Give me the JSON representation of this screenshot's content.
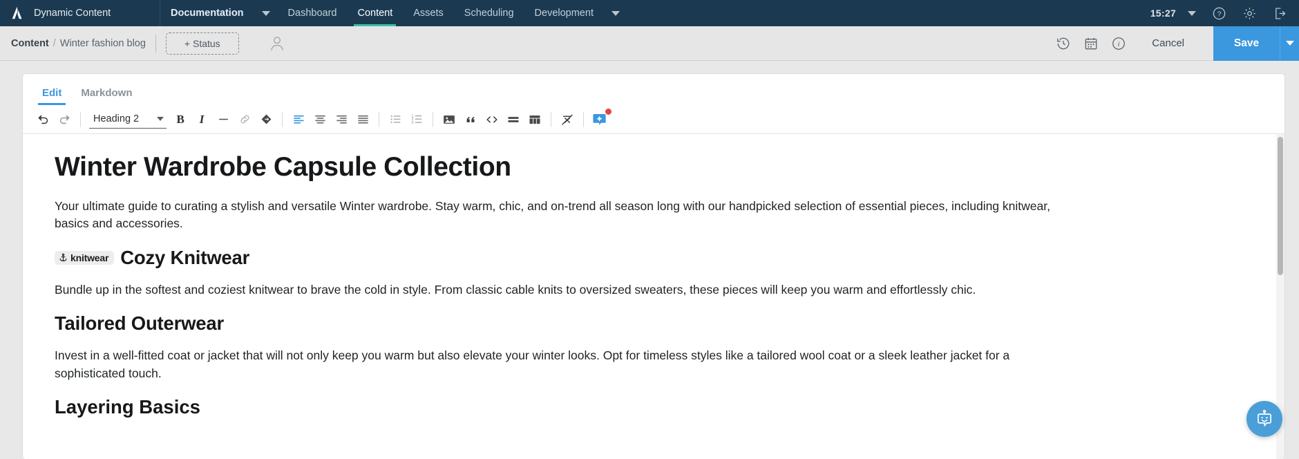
{
  "topnav": {
    "logo_icon": "amplience-logo-icon",
    "brand": "Dynamic Content",
    "items": [
      {
        "label": "Documentation",
        "icon": "",
        "active": false,
        "strong": true
      },
      {
        "label": "Dashboard",
        "active": false
      },
      {
        "label": "Content",
        "active": true
      },
      {
        "label": "Assets",
        "active": false
      },
      {
        "label": "Scheduling",
        "active": false
      },
      {
        "label": "Development",
        "active": false
      }
    ],
    "caret_icon": "chevron-down-icon",
    "clock": "15:27",
    "user_caret_icon": "chevron-down-icon",
    "help_icon": "help-circle-icon",
    "settings_icon": "gear-icon",
    "signout_icon": "sign-out-icon",
    "bg_color": "#1b3a52",
    "active_underline_color": "#39c0a5"
  },
  "subbar": {
    "crumb_root": "Content",
    "crumb_sep": "/",
    "crumb_current": "Winter fashion blog",
    "status_button": "+ Status",
    "avatar_icon": "user-avatar-icon",
    "history_icon": "history-clock-icon",
    "schedule_icon": "calendar-icon",
    "info_icon": "info-circle-icon",
    "cancel_label": "Cancel",
    "save_label": "Save",
    "save_caret_icon": "chevron-down-icon",
    "save_color": "#3b97de"
  },
  "editor": {
    "tabs": [
      {
        "label": "Edit",
        "active": true
      },
      {
        "label": "Markdown",
        "active": false
      }
    ],
    "toolbar": {
      "undo_icon": "undo-arrow-icon",
      "redo_icon": "redo-arrow-icon",
      "block_style": "Heading 2",
      "block_style_caret": "chevron-down-icon",
      "bold_label": "B",
      "italic_label": "I",
      "horizontal_rule_icon": "horizontal-rule-icon",
      "link_icon": "link-chain-icon",
      "anchor_icon": "anchor-tag-icon",
      "align_left_icon": "align-left-icon",
      "align_center_icon": "align-center-icon",
      "align_right_icon": "align-right-icon",
      "align_justify_icon": "align-justify-icon",
      "bullet_list_icon": "bulleted-list-icon",
      "numbered_list_icon": "numbered-list-icon",
      "image_icon": "image-icon",
      "quote_icon": "block-quote-icon",
      "code_icon": "code-brackets-icon",
      "content_block_icon": "content-block-icon",
      "table_icon": "table-icon",
      "clear_format_icon": "clear-formatting-icon",
      "ai_icon": "ai-sparkle-icon",
      "ai_badge_color": "#e8443a",
      "active_icon_color": "#3b97de"
    },
    "document": {
      "title": "Winter Wardrobe Capsule Collection",
      "intro": "Your ultimate guide to curating a stylish and versatile Winter wardrobe. Stay warm, chic, and on-trend all season long with our handpicked selection of essential pieces, including knitwear, basics and accessories.",
      "section1_anchor_icon": "anchor-icon",
      "section1_anchor": "knitwear",
      "section1_heading": "Cozy Knitwear",
      "section1_body": "Bundle up in the softest and coziest knitwear to brave the cold in style. From classic cable knits to oversized sweaters, these pieces will keep you warm and effortlessly chic.",
      "section2_heading": "Tailored Outerwear",
      "section2_body": "Invest in a well-fitted coat or jacket that will not only keep you warm but also elevate your winter looks. Opt for timeless styles like a tailored wool coat or a sleek leather jacket for a sophisticated touch.",
      "section3_heading_partial": "Layering Basics"
    },
    "scrollbar_icon": "vertical-scrollbar",
    "assistant_icon": "robot-chat-icon",
    "assistant_color": "#4a9fd8"
  }
}
